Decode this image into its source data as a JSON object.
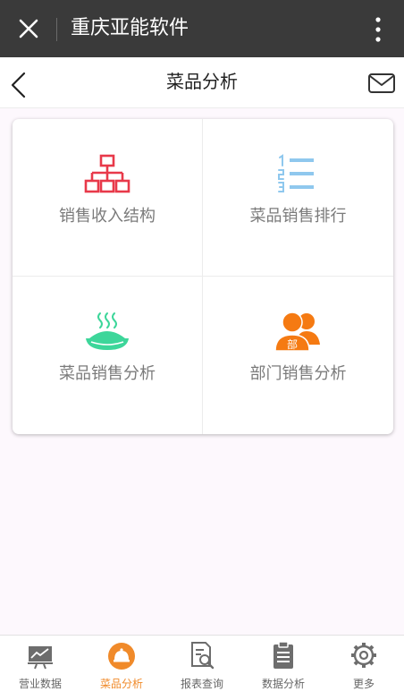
{
  "window": {
    "title": "重庆亚能软件",
    "close_icon": "close-icon",
    "more_icon": "more-vertical-icon"
  },
  "header": {
    "title": "菜品分析",
    "back_icon": "chevron-left-icon",
    "mail_icon": "mail-icon"
  },
  "grid": {
    "items": [
      {
        "label": "销售收入结构",
        "icon": "org-chart-icon",
        "color": "#e8394a"
      },
      {
        "label": "菜品销售排行",
        "icon": "ranking-list-icon",
        "color": "#8fc8ee"
      },
      {
        "label": "菜品销售分析",
        "icon": "steaming-dish-icon",
        "color": "#3dd69a"
      },
      {
        "label": "部门销售分析",
        "icon": "department-people-icon",
        "color": "#f57a12"
      }
    ]
  },
  "tabbar": {
    "active_index": 1,
    "active_color": "#f08a2a",
    "items": [
      {
        "label": "营业数据",
        "icon": "monitor-chart-icon"
      },
      {
        "label": "菜品分析",
        "icon": "cloche-icon"
      },
      {
        "label": "报表查询",
        "icon": "report-search-icon"
      },
      {
        "label": "数据分析",
        "icon": "clipboard-icon"
      },
      {
        "label": "更多",
        "icon": "gear-icon"
      }
    ]
  }
}
